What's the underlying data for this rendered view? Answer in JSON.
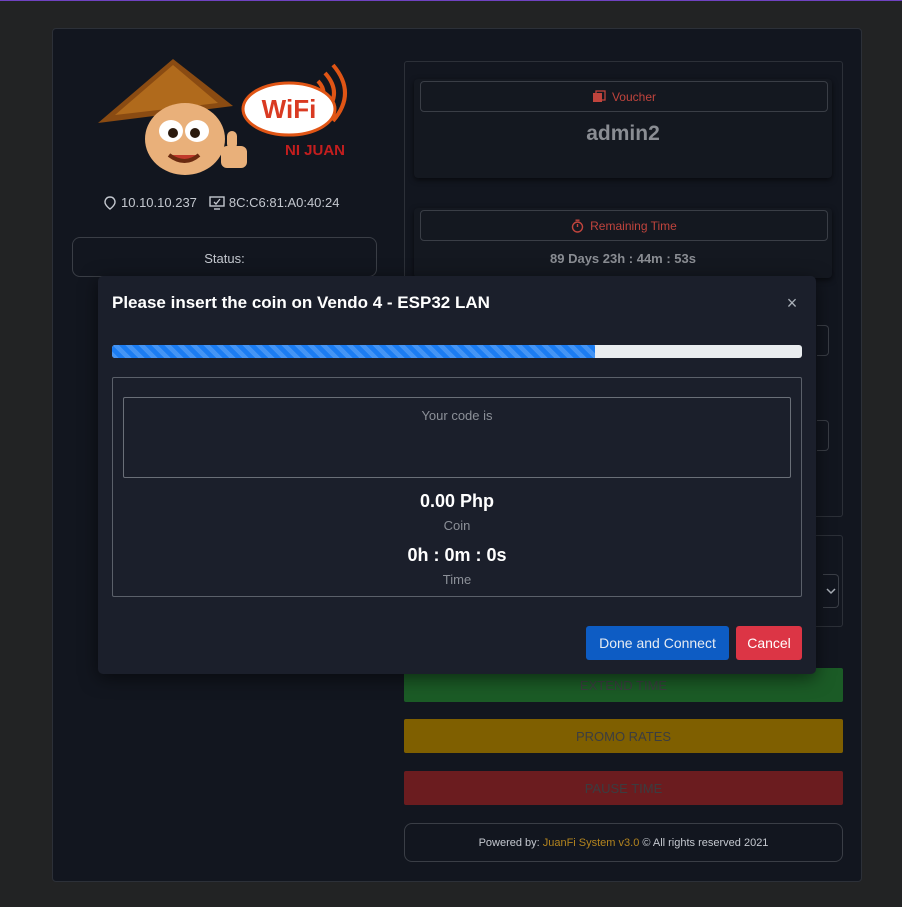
{
  "logo": {
    "wordmark": "WiFi",
    "subtitle": "NI JUAN"
  },
  "device": {
    "ip": "10.10.10.237",
    "mac": "8C:C6:81:A0:40:24"
  },
  "status": {
    "label": "Status:"
  },
  "voucher": {
    "label": "Voucher",
    "code": "admin2"
  },
  "remaining": {
    "label": "Remaining Time",
    "value": "89 Days 23h : 44m : 53s"
  },
  "actions": {
    "extend": "EXTEND TIME",
    "promo": "PROMO RATES",
    "pause": "PAUSE TIME"
  },
  "footer": {
    "prefix": "Powered by:",
    "brand": "JuanFi System v3.0",
    "suffix": "© All rights reserved 2021"
  },
  "modal": {
    "title": "Please insert the coin on Vendo 4 - ESP32 LAN",
    "close_symbol": "×",
    "progress_percent": 70,
    "code_label": "Your code is",
    "amount": "0.00 Php",
    "amount_label": "Coin",
    "time": "0h : 0m : 0s",
    "time_label": "Time",
    "done_label": "Done and Connect",
    "cancel_label": "Cancel"
  },
  "colors": {
    "accent_blue": "#0d5cc4",
    "cancel_red": "#dc3545",
    "voucher_red": "#c0443d",
    "brand_gold": "#b3841e"
  },
  "icons": [
    "voucher-icon",
    "timer-icon",
    "location-icon",
    "monitor-icon",
    "close-icon",
    "chevron-down-icon"
  ]
}
